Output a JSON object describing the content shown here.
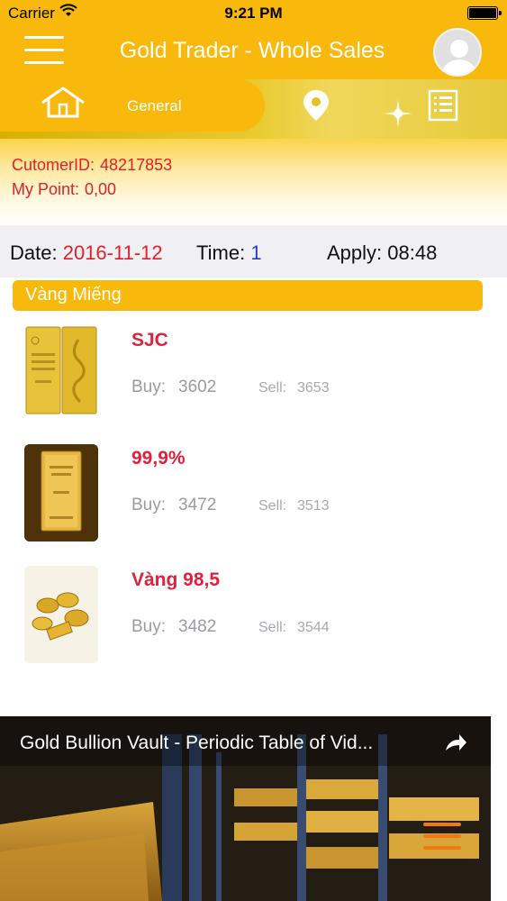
{
  "status": {
    "carrier": "Carrier",
    "time": "9:21 PM"
  },
  "header": {
    "title": "Gold Trader - Whole Sales"
  },
  "tabs": {
    "general": "General"
  },
  "customer": {
    "id_label": "CutomerID:",
    "id_value": "48217853",
    "point_label": "My Point:",
    "point_value": "0,00"
  },
  "datebar": {
    "date_label": "Date:",
    "date_value": "2016-11-12",
    "time_label": "Time:",
    "time_value": "1",
    "apply_label": "Apply:",
    "apply_value": "08:48"
  },
  "section": {
    "title": "Vàng Miếng"
  },
  "products": [
    {
      "name": "SJC",
      "buy_label": "Buy:",
      "buy": "3602",
      "sell_label": "Sell:",
      "sell": "3653"
    },
    {
      "name": "99,9%",
      "buy_label": "Buy:",
      "buy": "3472",
      "sell_label": "Sell:",
      "sell": "3513"
    },
    {
      "name": "Vàng 98,5",
      "buy_label": "Buy:",
      "buy": "3482",
      "sell_label": "Sell:",
      "sell": "3544"
    }
  ],
  "video": {
    "title": "Gold Bullion Vault - Periodic Table of Vid..."
  },
  "colors": {
    "accent": "#F8B80C",
    "price_red": "#E0203E",
    "muted": "#9A9AA0"
  }
}
